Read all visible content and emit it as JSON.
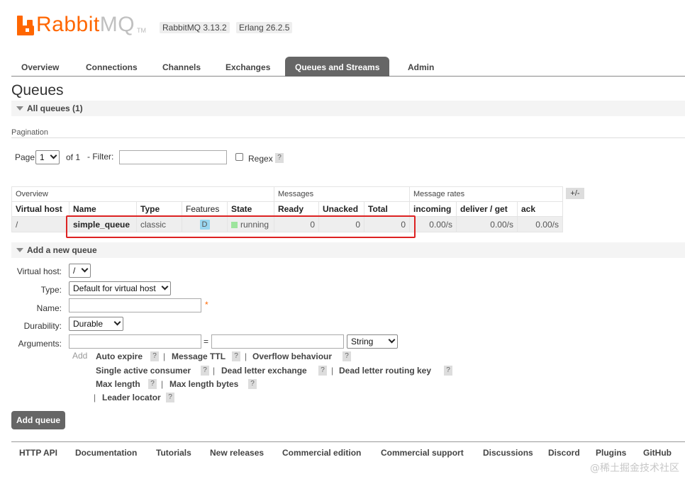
{
  "header": {
    "logo_text": "Rabbit",
    "logo_text_mq": "MQ",
    "logo_tm": "TM",
    "rabbitmq_version": "RabbitMQ 3.13.2",
    "erlang_version": "Erlang 26.2.5"
  },
  "nav": {
    "tabs": [
      "Overview",
      "Connections",
      "Channels",
      "Exchanges",
      "Queues and Streams",
      "Admin"
    ],
    "active": "Queues and Streams"
  },
  "page": {
    "title": "Queues",
    "all_queues": "All queues (1)",
    "pagination_label": "Pagination",
    "page_label": "Page",
    "page_value": "1",
    "of_label": "of 1",
    "filter_label": "- Filter:",
    "regex_label": "Regex",
    "help": "?",
    "plus_minus": "+/-"
  },
  "table": {
    "groups": [
      "Overview",
      "Messages",
      "Message rates"
    ],
    "columns": [
      "Virtual host",
      "Name",
      "Type",
      "Features",
      "State",
      "Ready",
      "Unacked",
      "Total",
      "incoming",
      "deliver / get",
      "ack"
    ],
    "row": {
      "vhost": "/",
      "name": "simple_queue",
      "type": "classic",
      "feature": "D",
      "state": "running",
      "ready": "0",
      "unacked": "0",
      "total": "0",
      "incoming": "0.00/s",
      "deliver_get": "0.00/s",
      "ack": "0.00/s"
    }
  },
  "add_queue": {
    "heading": "Add a new queue",
    "virtual_host_label": "Virtual host:",
    "virtual_host_value": "/",
    "type_label": "Type:",
    "type_value": "Default for virtual host",
    "name_label": "Name:",
    "required_mark": "*",
    "durability_label": "Durability:",
    "durability_value": "Durable",
    "arguments_label": "Arguments:",
    "equals": "=",
    "arg_type_value": "String",
    "add_label": "Add",
    "arg_links": [
      "Auto expire",
      "Message TTL",
      "Overflow behaviour",
      "Single active consumer",
      "Dead letter exchange",
      "Dead letter routing key",
      "Max length",
      "Max length bytes",
      "Leader locator"
    ],
    "separator": "|",
    "submit": "Add queue"
  },
  "footer": {
    "links": [
      "HTTP API",
      "Documentation",
      "Tutorials",
      "New releases",
      "Commercial edition",
      "Commercial support",
      "Discussions",
      "Discord",
      "Plugins",
      "GitHub"
    ]
  },
  "watermark": "@稀土掘金技术社区",
  "colors": {
    "brand": "#ff6600",
    "tab_active": "#666666",
    "highlight": "#dd2222",
    "running": "#9de49d",
    "durable_badge": "#99d6f0"
  }
}
